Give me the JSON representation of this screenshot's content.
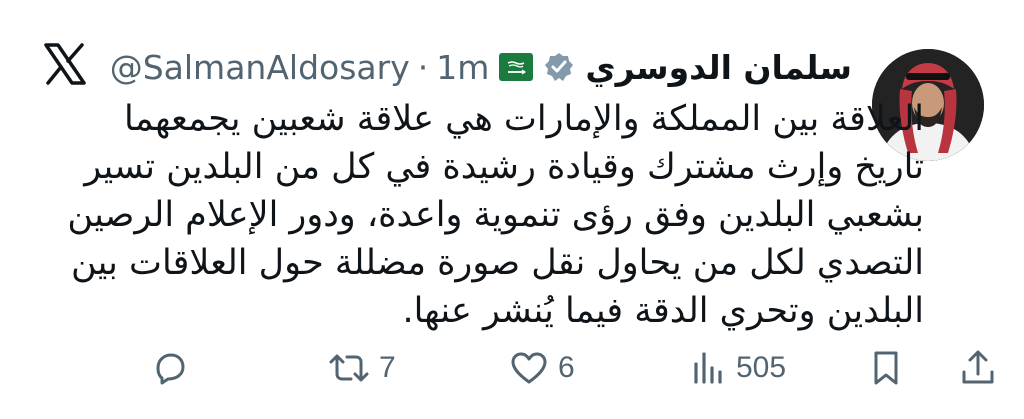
{
  "author": {
    "display_name": "سلمان الدوسري",
    "handle": "@SalmanAldosary",
    "separator": "·",
    "time": "1m",
    "verified": true,
    "affiliation_badge": "saudi-flag-icon"
  },
  "tweet": {
    "lines": [
      "العلاقة بين المملكة والإمارات هي علاقة شعبين يجمعهما",
      "تاريخ وإرث مشترك وقيادة رشيدة في كل من البلدين تسير",
      "بشعبي البلدين وفق رؤى تنموية واعدة، ودور الإعلام الرصين",
      "التصدي لكل من يحاول نقل صورة مضللة حول العلاقات بين",
      "البلدين وتحري الدقة فيما يُنشر عنها."
    ]
  },
  "actions": {
    "reply_count": "",
    "retweet_count": "7",
    "like_count": "6",
    "views_count": "505"
  },
  "colors": {
    "text": "#0f1419",
    "secondary": "#536471",
    "verified": "#829aab",
    "flag": "#1b7a3e"
  }
}
